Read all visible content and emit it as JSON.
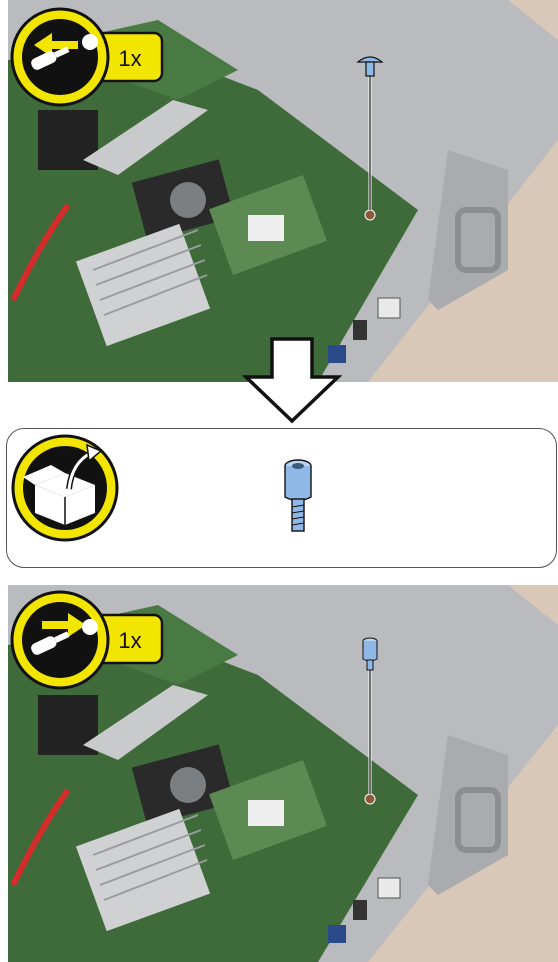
{
  "steps": [
    {
      "action": "remove-screw",
      "quantity_label": "1x"
    },
    {
      "action": "from-package"
    },
    {
      "action": "install-standoff",
      "quantity_label": "1x"
    }
  ],
  "colors": {
    "badge_yellow": "#f2e600",
    "badge_black": "#111111",
    "pcb_green": "#3f6b3a",
    "chassis_gray": "#b9bbbe",
    "tabletop": "#d9c8b8",
    "part_blue": "#8fb8e6"
  },
  "icons": [
    "screw-out-icon",
    "down-arrow-icon",
    "open-box-icon",
    "standoff-icon",
    "screw-in-icon"
  ]
}
